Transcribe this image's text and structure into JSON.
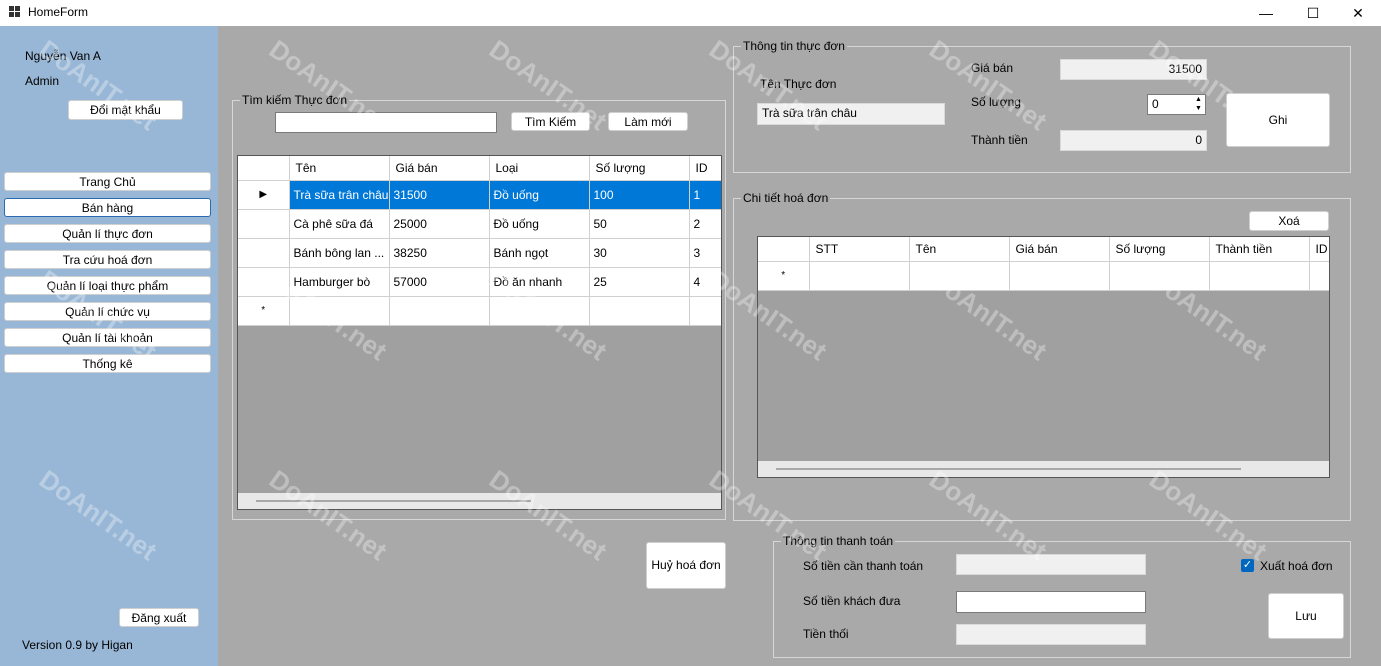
{
  "window": {
    "title": "HomeForm",
    "minimize": "—",
    "maximize": "☐",
    "close": "✕"
  },
  "sidebar": {
    "user_name": "Nguyễn Van A",
    "role": "Admin",
    "change_password": "Đổi mật khẩu",
    "nav": [
      "Trang Chủ",
      "Bán hàng",
      "Quản lí thực đơn",
      "Tra cứu hoá đơn",
      "Quản lí loại thực phẩm",
      "Quản lí chức vụ",
      "Quản lí tài khoản",
      "Thống kê"
    ],
    "logout": "Đăng xuất",
    "version": "Version 0.9 by Higan"
  },
  "search": {
    "group_title": "Tìm kiếm Thực đơn",
    "input_value": "",
    "search_button": "Tìm Kiếm",
    "refresh_button": "Làm mới"
  },
  "menu_grid": {
    "columns": [
      "Tên",
      "Giá bán",
      "Loại",
      "Số lượng",
      "ID"
    ],
    "rows": [
      {
        "name": "Trà sữa trân châu",
        "price": "31500",
        "type": "Đồ uống",
        "qty": "100",
        "id": "1",
        "selected": true
      },
      {
        "name": "Cà phê sữa đá",
        "price": "25000",
        "type": "Đồ uống",
        "qty": "50",
        "id": "2"
      },
      {
        "name": "Bánh bông lan ...",
        "price": "38250",
        "type": "Bánh ngọt",
        "qty": "30",
        "id": "3"
      },
      {
        "name": "Hamburger bò",
        "price": "57000",
        "type": "Đồ ăn nhanh",
        "qty": "25",
        "id": "4"
      }
    ],
    "new_row_marker": "*",
    "current_row_marker": "▶"
  },
  "menu_info": {
    "group_title": "Thông tin thực đơn",
    "name_label": "Tên Thực đơn",
    "name_value": "Trà sữa trân châu",
    "price_label": "Giá bán",
    "price_value": "31500",
    "qty_label": "Số lượng",
    "qty_value": "0",
    "total_label": "Thành tiền",
    "total_value": "0",
    "save_button": "Ghi"
  },
  "invoice_detail": {
    "group_title": "Chi tiết hoá đơn",
    "delete_button": "Xoá",
    "columns": [
      "STT",
      "Tên",
      "Giá bán",
      "Số lượng",
      "Thành tiền",
      "ID"
    ],
    "new_row_marker": "*"
  },
  "cancel_invoice": "Huỷ hoá đơn",
  "payment": {
    "group_title": "Thông tin thanh toán",
    "due_label": "Số tiền cần thanh toán",
    "due_value": "",
    "paid_label": "Số tiền khách đưa",
    "paid_value": "",
    "change_label": "Tiền thối",
    "change_value": "",
    "export_label": "Xuất hoá đơn",
    "export_checked": true,
    "save_button": "Lưu"
  },
  "colors": {
    "sidebar": "#98b7d6",
    "background": "#a9a9a9",
    "selection": "#0078d7",
    "checkbox": "#0067c0"
  }
}
